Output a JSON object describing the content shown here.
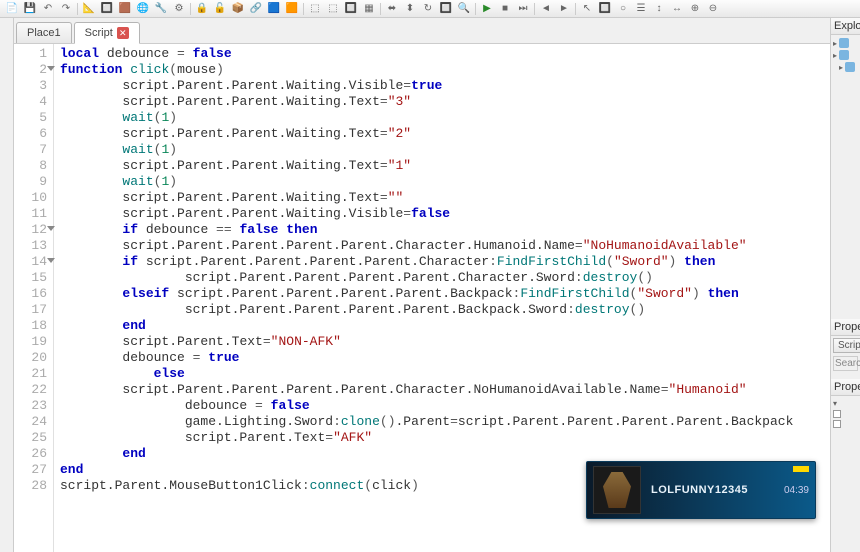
{
  "toolbar": {
    "icons": [
      "📄",
      "💾",
      "↶",
      "↷",
      "|",
      "📐",
      "🔲",
      "🟫",
      "🌐",
      "🔧",
      "⚙",
      "|",
      "🔒",
      "🔓",
      "📦",
      "🔗",
      "🟦",
      "🟧",
      "|",
      "⬚",
      "⬚",
      "🔲",
      "▦",
      "|",
      "⬌",
      "⬍",
      "↻",
      "🔲",
      "🔍",
      "|",
      "▶",
      "■",
      "⏭",
      "|",
      "◄",
      "►",
      "|",
      "↖",
      "🔲",
      "○",
      "☰",
      "↕",
      "↔",
      "⊕",
      "⊖"
    ]
  },
  "tabs": [
    {
      "label": "Place1",
      "active": false,
      "closable": false
    },
    {
      "label": "Script",
      "active": true,
      "closable": true
    }
  ],
  "right": {
    "explorer_title": "Explorer",
    "properties_title": "Properties",
    "script_btn": "Script",
    "search_placeholder": "Search"
  },
  "notification": {
    "name": "LOLFUNNY12345",
    "time": "04:39"
  },
  "code": [
    {
      "indent": 0,
      "tokens": [
        [
          "kw",
          "local"
        ],
        [
          "ident",
          " debounce "
        ],
        [
          "pun",
          "="
        ],
        [
          "ident",
          " "
        ],
        [
          "bool",
          "false"
        ]
      ]
    },
    {
      "indent": 0,
      "fold": true,
      "tokens": [
        [
          "kw",
          "function"
        ],
        [
          "ident",
          " "
        ],
        [
          "blt",
          "click"
        ],
        [
          "pun",
          "("
        ],
        [
          "ident",
          "mouse"
        ],
        [
          "pun",
          ")"
        ]
      ]
    },
    {
      "indent": 2,
      "tokens": [
        [
          "ident",
          "script.Parent.Parent.Waiting.Visible"
        ],
        [
          "pun",
          "="
        ],
        [
          "bool",
          "true"
        ]
      ]
    },
    {
      "indent": 2,
      "tokens": [
        [
          "ident",
          "script.Parent.Parent.Waiting.Text"
        ],
        [
          "pun",
          "="
        ],
        [
          "str",
          "\"3\""
        ]
      ]
    },
    {
      "indent": 2,
      "tokens": [
        [
          "blt",
          "wait"
        ],
        [
          "pun",
          "("
        ],
        [
          "num",
          "1"
        ],
        [
          "pun",
          ")"
        ]
      ]
    },
    {
      "indent": 2,
      "tokens": [
        [
          "ident",
          "script.Parent.Parent.Waiting.Text"
        ],
        [
          "pun",
          "="
        ],
        [
          "str",
          "\"2\""
        ]
      ]
    },
    {
      "indent": 2,
      "tokens": [
        [
          "blt",
          "wait"
        ],
        [
          "pun",
          "("
        ],
        [
          "num",
          "1"
        ],
        [
          "pun",
          ")"
        ]
      ]
    },
    {
      "indent": 2,
      "tokens": [
        [
          "ident",
          "script.Parent.Parent.Waiting.Text"
        ],
        [
          "pun",
          "="
        ],
        [
          "str",
          "\"1\""
        ]
      ]
    },
    {
      "indent": 2,
      "tokens": [
        [
          "blt",
          "wait"
        ],
        [
          "pun",
          "("
        ],
        [
          "num",
          "1"
        ],
        [
          "pun",
          ")"
        ]
      ]
    },
    {
      "indent": 2,
      "tokens": [
        [
          "ident",
          "script.Parent.Parent.Waiting.Text"
        ],
        [
          "pun",
          "="
        ],
        [
          "str",
          "\"\""
        ]
      ]
    },
    {
      "indent": 2,
      "tokens": [
        [
          "ident",
          "script.Parent.Parent.Waiting.Visible"
        ],
        [
          "pun",
          "="
        ],
        [
          "bool",
          "false"
        ]
      ]
    },
    {
      "indent": 2,
      "fold": true,
      "tokens": [
        [
          "kw",
          "if"
        ],
        [
          "ident",
          " debounce "
        ],
        [
          "pun",
          "=="
        ],
        [
          "ident",
          " "
        ],
        [
          "bool",
          "false"
        ],
        [
          "ident",
          " "
        ],
        [
          "kw",
          "then"
        ]
      ]
    },
    {
      "indent": 2,
      "tokens": [
        [
          "ident",
          "script.Parent.Parent.Parent.Parent.Character.Humanoid.Name"
        ],
        [
          "pun",
          "="
        ],
        [
          "str",
          "\"NoHumanoidAvailable\""
        ]
      ]
    },
    {
      "indent": 2,
      "fold": true,
      "tokens": [
        [
          "kw",
          "if"
        ],
        [
          "ident",
          " script.Parent.Parent.Parent.Parent.Character"
        ],
        [
          "pun",
          ":"
        ],
        [
          "blt",
          "FindFirstChild"
        ],
        [
          "pun",
          "("
        ],
        [
          "str",
          "\"Sword\""
        ],
        [
          "pun",
          ")"
        ],
        [
          "ident",
          " "
        ],
        [
          "kw",
          "then"
        ]
      ]
    },
    {
      "indent": 4,
      "tokens": [
        [
          "ident",
          "script.Parent.Parent.Parent.Parent.Character.Sword"
        ],
        [
          "pun",
          ":"
        ],
        [
          "blt",
          "destroy"
        ],
        [
          "pun",
          "()"
        ]
      ]
    },
    {
      "indent": 2,
      "tokens": [
        [
          "kw",
          "elseif"
        ],
        [
          "ident",
          " script.Parent.Parent.Parent.Parent.Backpack"
        ],
        [
          "pun",
          ":"
        ],
        [
          "blt",
          "FindFirstChild"
        ],
        [
          "pun",
          "("
        ],
        [
          "str",
          "\"Sword\""
        ],
        [
          "pun",
          ")"
        ],
        [
          "ident",
          " "
        ],
        [
          "kw",
          "then"
        ]
      ]
    },
    {
      "indent": 4,
      "tokens": [
        [
          "ident",
          "script.Parent.Parent.Parent.Parent.Backpack.Sword"
        ],
        [
          "pun",
          ":"
        ],
        [
          "blt",
          "destroy"
        ],
        [
          "pun",
          "()"
        ]
      ]
    },
    {
      "indent": 2,
      "tokens": [
        [
          "kw",
          "end"
        ]
      ]
    },
    {
      "indent": 2,
      "tokens": [
        [
          "ident",
          "script.Parent.Text"
        ],
        [
          "pun",
          "="
        ],
        [
          "str",
          "\"NON-AFK\""
        ]
      ]
    },
    {
      "indent": 2,
      "tokens": [
        [
          "ident",
          "debounce "
        ],
        [
          "pun",
          "="
        ],
        [
          "ident",
          " "
        ],
        [
          "bool",
          "true"
        ]
      ]
    },
    {
      "indent": 3,
      "tokens": [
        [
          "kw",
          "else"
        ]
      ]
    },
    {
      "indent": 2,
      "tokens": [
        [
          "ident",
          "script.Parent.Parent.Parent.Parent.Character.NoHumanoidAvailable.Name"
        ],
        [
          "pun",
          "="
        ],
        [
          "str",
          "\"Humanoid\""
        ]
      ]
    },
    {
      "indent": 4,
      "tokens": [
        [
          "ident",
          "debounce "
        ],
        [
          "pun",
          "="
        ],
        [
          "ident",
          " "
        ],
        [
          "bool",
          "false"
        ]
      ]
    },
    {
      "indent": 4,
      "tokens": [
        [
          "ident",
          "game.Lighting.Sword"
        ],
        [
          "pun",
          ":"
        ],
        [
          "blt",
          "clone"
        ],
        [
          "pun",
          "()"
        ],
        [
          "ident",
          ".Parent"
        ],
        [
          "pun",
          "="
        ],
        [
          "ident",
          "script.Parent.Parent.Parent.Parent.Backpack"
        ]
      ]
    },
    {
      "indent": 4,
      "tokens": [
        [
          "ident",
          "script.Parent.Text"
        ],
        [
          "pun",
          "="
        ],
        [
          "str",
          "\"AFK\""
        ]
      ]
    },
    {
      "indent": 2,
      "tokens": [
        [
          "kw",
          "end"
        ]
      ]
    },
    {
      "indent": 0,
      "tokens": [
        [
          "kw",
          "end"
        ]
      ]
    },
    {
      "indent": 0,
      "tokens": [
        [
          "ident",
          "script.Parent.MouseButton1Click"
        ],
        [
          "pun",
          ":"
        ],
        [
          "blt",
          "connect"
        ],
        [
          "pun",
          "("
        ],
        [
          "ident",
          "click"
        ],
        [
          "pun",
          ")"
        ]
      ]
    }
  ]
}
